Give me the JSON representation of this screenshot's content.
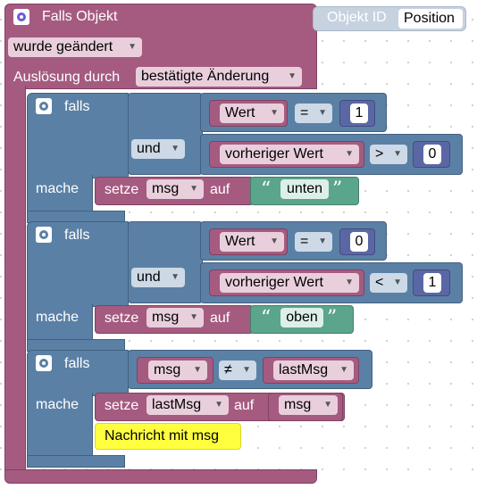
{
  "event_block": {
    "title": "Falls Objekt",
    "object_id_label": "Objekt ID",
    "object_id_value": "Position",
    "changed_dropdown": "wurde geändert",
    "trigger_label": "Auslösung durch",
    "trigger_dropdown": "bestätigte Änderung"
  },
  "if_blocks": [
    {
      "if_label": "falls",
      "do_label": "mache",
      "logic_op": "und",
      "cond1": {
        "var": "Wert",
        "op": "=",
        "num": "1"
      },
      "cond2": {
        "var": "vorheriger Wert",
        "op": ">",
        "num": "0"
      },
      "set_label": "setze",
      "set_var": "msg",
      "to_label": "auf",
      "text": "unten"
    },
    {
      "if_label": "falls",
      "do_label": "mache",
      "logic_op": "und",
      "cond1": {
        "var": "Wert",
        "op": "=",
        "num": "0"
      },
      "cond2": {
        "var": "vorheriger Wert",
        "op": "<",
        "num": "1"
      },
      "set_label": "setze",
      "set_var": "msg",
      "to_label": "auf",
      "text": "oben"
    },
    {
      "if_label": "falls",
      "do_label": "mache",
      "cond": {
        "left": "msg",
        "op": "≠",
        "right": "lastMsg"
      },
      "set_label": "setze",
      "set_var": "lastMsg",
      "to_label": "auf",
      "value": "msg",
      "comment": "Nachricht mit msg"
    }
  ],
  "colors": {
    "event": "#a55b80",
    "logic": "#5b80a5",
    "text": "#5ba58c",
    "number": "#5b67a5",
    "comment": "#ffff40"
  }
}
